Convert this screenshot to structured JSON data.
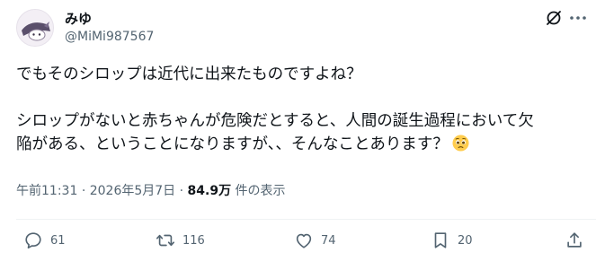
{
  "author": {
    "display_name": "みゆ",
    "handle": "@MiMi987567"
  },
  "icons": {
    "top_right": [
      "grok-icon",
      "more-icon"
    ],
    "actions": [
      "reply-icon",
      "repost-icon",
      "like-icon",
      "bookmark-icon",
      "share-icon"
    ]
  },
  "tweet": {
    "line1": "でもそのシロップは近代に出来たものですよね？",
    "line2": "シロップがないと赤ちゃんが危険だとすると、人間の誕生過程において欠",
    "line3": "陥がある、ということになりますが、、そんなことあります？",
    "emoji": "pleading-face"
  },
  "meta": {
    "time": "午前11:31",
    "separator": "·",
    "date": "2026年5月7日",
    "views": "84.9万",
    "views_label": "件の表示"
  },
  "actions": {
    "replies": "61",
    "reposts": "116",
    "likes": "74",
    "bookmarks": "20"
  },
  "colors": {
    "text": "#0f1419",
    "secondary": "#536471",
    "divider": "#eff3f4"
  }
}
